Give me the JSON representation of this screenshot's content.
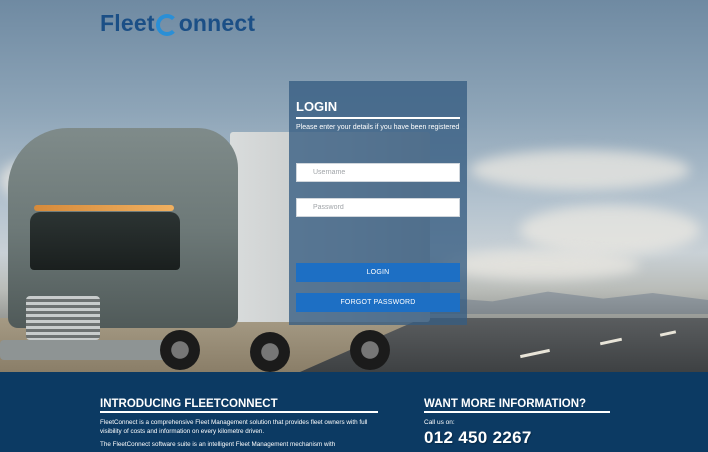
{
  "brand": {
    "logo_prefix": "Fleet",
    "logo_suffix": "onnect",
    "accent_color": "#2a8fd6",
    "primary_color": "#1b4f86"
  },
  "login": {
    "title": "LOGIN",
    "subtitle": "Please enter your details if you have been registered",
    "username_placeholder": "Username",
    "password_placeholder": "Password",
    "login_button": "LOGIN",
    "forgot_button": "FORGOT PASSWORD",
    "button_color": "#1d6fc4"
  },
  "footer": {
    "intro": {
      "title": "INTRODUCING FLEETCONNECT",
      "paragraph1": "FleetConnect is a comprehensive Fleet Management solution that provides fleet owners with full visibility of costs and information on every kilometre driven.",
      "paragraph2": "The FleetConnect software suite is an intelligent Fleet Management mechanism with"
    },
    "more_info": {
      "title": "WANT MORE INFORMATION?",
      "call_label": "Call us on:",
      "phone": "012 450 2267"
    },
    "background_color": "#0c3a63"
  }
}
